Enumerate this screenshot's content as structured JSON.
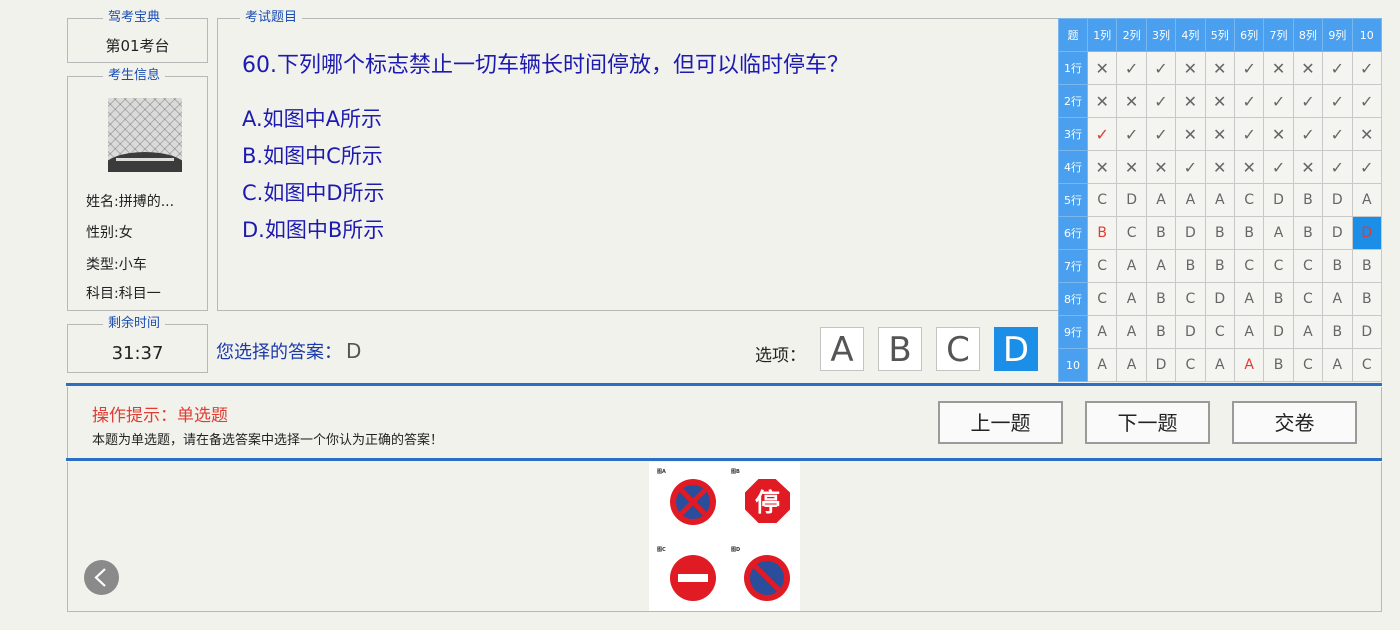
{
  "exam_station": {
    "legend": "驾考宝典",
    "value": "第01考台"
  },
  "candidate": {
    "legend": "考生信息",
    "name": "姓名:拼搏的...",
    "gender": "性别:女",
    "type": "类型:小车",
    "subject": "科目:科目一"
  },
  "timer": {
    "legend": "剩余时间",
    "value": "31:37"
  },
  "question": {
    "legend": "考试题目",
    "text": "60.下列哪个标志禁止一切车辆长时间停放，但可以临时停车？",
    "options": [
      "A.如图中A所示",
      "B.如图中C所示",
      "C.如图中D所示",
      "D.如图中B所示"
    ]
  },
  "selection": {
    "label": "您选择的答案：",
    "answer": "D",
    "choices_label": "选项：",
    "choices": [
      "A",
      "B",
      "C",
      "D"
    ],
    "selected": "D",
    "accent_color": "#1b8ee8"
  },
  "grid": {
    "corner": "题",
    "col_headers": [
      "1列",
      "2列",
      "3列",
      "4列",
      "5列",
      "6列",
      "7列",
      "8列",
      "9列",
      "10"
    ],
    "rows": [
      {
        "label": "1行",
        "cells": [
          "✕",
          "✓",
          "✓",
          "✕",
          "✕",
          "✓",
          "✕",
          "✕",
          "✓",
          "✓"
        ]
      },
      {
        "label": "2行",
        "cells": [
          "✕",
          "✕",
          "✓",
          "✕",
          "✕",
          "✓",
          "✓",
          "✓",
          "✓",
          "✓"
        ]
      },
      {
        "label": "3行",
        "cells": [
          "✓",
          "✓",
          "✓",
          "✕",
          "✕",
          "✓",
          "✕",
          "✓",
          "✓",
          "✕"
        ]
      },
      {
        "label": "4行",
        "cells": [
          "✕",
          "✕",
          "✕",
          "✓",
          "✕",
          "✕",
          "✓",
          "✕",
          "✓",
          "✓"
        ]
      },
      {
        "label": "5行",
        "cells": [
          "C",
          "D",
          "A",
          "A",
          "A",
          "C",
          "D",
          "B",
          "D",
          "A"
        ]
      },
      {
        "label": "6行",
        "cells": [
          "B",
          "C",
          "B",
          "D",
          "B",
          "B",
          "A",
          "B",
          "D",
          "D"
        ]
      },
      {
        "label": "7行",
        "cells": [
          "C",
          "A",
          "A",
          "B",
          "B",
          "C",
          "C",
          "C",
          "B",
          "B"
        ]
      },
      {
        "label": "8行",
        "cells": [
          "C",
          "A",
          "B",
          "C",
          "D",
          "A",
          "B",
          "C",
          "A",
          "B"
        ]
      },
      {
        "label": "9行",
        "cells": [
          "A",
          "A",
          "B",
          "D",
          "C",
          "A",
          "D",
          "A",
          "B",
          "D"
        ]
      },
      {
        "label": "10",
        "cells": [
          "A",
          "A",
          "D",
          "C",
          "A",
          "A",
          "B",
          "C",
          "A",
          "C"
        ]
      }
    ],
    "red_cells": [
      [
        2,
        0
      ],
      [
        5,
        0
      ],
      [
        9,
        5
      ]
    ],
    "current_cell": [
      5,
      9
    ],
    "header_color": "#4aa0ee",
    "wrong_color": "#e23b32"
  },
  "tips": {
    "title": "操作提示：单选题",
    "text": "本题为单选题，请在备选答案中选择一个你认为正确的答案！"
  },
  "buttons": {
    "prev": "上一题",
    "next": "下一题",
    "submit": "交卷"
  },
  "signs": {
    "caption_a": "图A",
    "caption_b": "图B",
    "caption_c": "图C",
    "caption_d": "图D",
    "stop_text": "停"
  }
}
